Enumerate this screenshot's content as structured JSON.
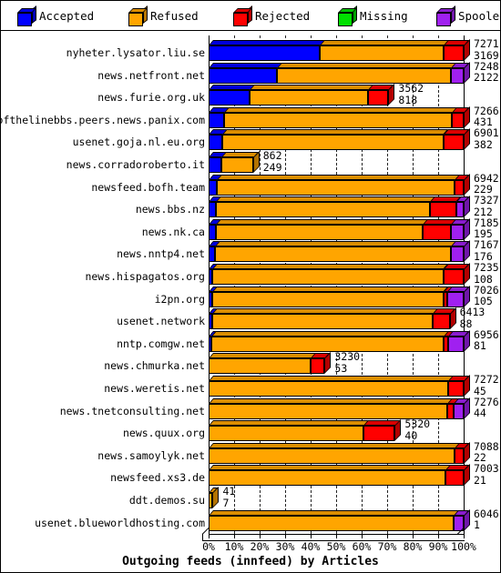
{
  "legend": {
    "items": [
      {
        "label": "Accepted",
        "color": "#0000ff",
        "icon": "cube-icon"
      },
      {
        "label": "Refused",
        "color": "#ffa500",
        "icon": "cube-icon"
      },
      {
        "label": "Rejected",
        "color": "#ff0000",
        "icon": "cube-icon"
      },
      {
        "label": "Missing",
        "color": "#00e000",
        "icon": "cube-icon"
      },
      {
        "label": "Spooled",
        "color": "#a020f0",
        "icon": "cube-icon"
      }
    ]
  },
  "chart_data": {
    "type": "bar",
    "orientation": "horizontal",
    "stacked": true,
    "percent_stacked": true,
    "title": "Outgoing feeds (innfeed) by Articles",
    "xlabel": "Outgoing feeds (innfeed) by Articles",
    "ylabel": "",
    "xlim": [
      0,
      100
    ],
    "xticks": [
      "0%",
      "10%",
      "20%",
      "30%",
      "40%",
      "50%",
      "60%",
      "70%",
      "80%",
      "90%",
      "100%"
    ],
    "grid": true,
    "legend_position": "top",
    "series": [
      {
        "name": "Accepted",
        "color": "#0000ff"
      },
      {
        "name": "Refused",
        "color": "#ffa500"
      },
      {
        "name": "Rejected",
        "color": "#ff0000"
      },
      {
        "name": "Missing",
        "color": "#00e000"
      },
      {
        "name": "Spooled",
        "color": "#a020f0"
      }
    ],
    "categories": [
      "nyheter.lysator.liu.se",
      "news.netfront.net",
      "news.furie.org.uk",
      "endofthelinebbs.peers.news.panix.com",
      "usenet.goja.nl.eu.org",
      "news.corradoroberto.it",
      "newsfeed.bofh.team",
      "news.bbs.nz",
      "news.nk.ca",
      "news.nntp4.net",
      "news.hispagatos.org",
      "i2pn.org",
      "usenet.network",
      "nntp.comgw.net",
      "news.chmurka.net",
      "news.weretis.net",
      "news.tnetconsulting.net",
      "news.quux.org",
      "news.samoylyk.net",
      "newsfeed.xs3.de",
      "ddt.demos.su",
      "usenet.blueworldhosting.com"
    ],
    "rows": [
      {
        "category": "nyheter.lysator.liu.se",
        "total": 7271,
        "value2": 3169,
        "bar_len_pct": 100,
        "labels_inside": false,
        "segments": [
          {
            "s": "Accepted",
            "pct": 43.6
          },
          {
            "s": "Refused",
            "pct": 48.4
          },
          {
            "s": "Rejected",
            "pct": 8.0
          }
        ]
      },
      {
        "category": "news.netfront.net",
        "total": 7248,
        "value2": 2122,
        "bar_len_pct": 100,
        "labels_inside": false,
        "segments": [
          {
            "s": "Accepted",
            "pct": 26.8
          },
          {
            "s": "Refused",
            "pct": 68.2
          },
          {
            "s": "Spooled",
            "pct": 5.0
          }
        ]
      },
      {
        "category": "news.furie.org.uk",
        "total": 3562,
        "value2": 818,
        "bar_len_pct": 70.5,
        "labels_inside": true,
        "segments": [
          {
            "s": "Accepted",
            "pct": 22.9
          },
          {
            "s": "Refused",
            "pct": 66.0
          },
          {
            "s": "Rejected",
            "pct": 11.1
          }
        ]
      },
      {
        "category": "endofthelinebbs.peers.news.panix.com",
        "total": 7266,
        "value2": 431,
        "bar_len_pct": 100,
        "labels_inside": false,
        "segments": [
          {
            "s": "Accepted",
            "pct": 5.9
          },
          {
            "s": "Refused",
            "pct": 89.6
          },
          {
            "s": "Rejected",
            "pct": 4.5
          }
        ]
      },
      {
        "category": "usenet.goja.nl.eu.org",
        "total": 6901,
        "value2": 382,
        "bar_len_pct": 100,
        "labels_inside": false,
        "segments": [
          {
            "s": "Accepted",
            "pct": 5.5
          },
          {
            "s": "Refused",
            "pct": 86.5
          },
          {
            "s": "Rejected",
            "pct": 8.0
          }
        ]
      },
      {
        "category": "news.corradoroberto.it",
        "total": 862,
        "value2": 249,
        "bar_len_pct": 17.4,
        "labels_inside": true,
        "segments": [
          {
            "s": "Accepted",
            "pct": 28.9
          },
          {
            "s": "Refused",
            "pct": 71.1
          }
        ]
      },
      {
        "category": "newsfeed.bofh.team",
        "total": 6942,
        "value2": 229,
        "bar_len_pct": 100,
        "labels_inside": false,
        "segments": [
          {
            "s": "Accepted",
            "pct": 3.3
          },
          {
            "s": "Refused",
            "pct": 93.2
          },
          {
            "s": "Rejected",
            "pct": 3.5
          }
        ]
      },
      {
        "category": "news.bbs.nz",
        "total": 7327,
        "value2": 212,
        "bar_len_pct": 100,
        "labels_inside": false,
        "segments": [
          {
            "s": "Accepted",
            "pct": 2.9
          },
          {
            "s": "Refused",
            "pct": 84.0
          },
          {
            "s": "Rejected",
            "pct": 10.1
          },
          {
            "s": "Spooled",
            "pct": 3.0
          }
        ]
      },
      {
        "category": "news.nk.ca",
        "total": 7185,
        "value2": 195,
        "bar_len_pct": 100,
        "labels_inside": false,
        "segments": [
          {
            "s": "Accepted",
            "pct": 2.7
          },
          {
            "s": "Refused",
            "pct": 81.3
          },
          {
            "s": "Rejected",
            "pct": 11.0
          },
          {
            "s": "Spooled",
            "pct": 5.0
          }
        ]
      },
      {
        "category": "news.nntp4.net",
        "total": 7167,
        "value2": 176,
        "bar_len_pct": 100,
        "labels_inside": false,
        "segments": [
          {
            "s": "Accepted",
            "pct": 2.5
          },
          {
            "s": "Refused",
            "pct": 92.5
          },
          {
            "s": "Spooled",
            "pct": 5.0
          }
        ]
      },
      {
        "category": "news.hispagatos.org",
        "total": 7235,
        "value2": 108,
        "bar_len_pct": 100,
        "labels_inside": false,
        "segments": [
          {
            "s": "Accepted",
            "pct": 1.5
          },
          {
            "s": "Refused",
            "pct": 90.5
          },
          {
            "s": "Rejected",
            "pct": 8.0
          }
        ]
      },
      {
        "category": "i2pn.org",
        "total": 7026,
        "value2": 105,
        "bar_len_pct": 100,
        "labels_inside": false,
        "segments": [
          {
            "s": "Accepted",
            "pct": 1.5
          },
          {
            "s": "Refused",
            "pct": 90.5
          },
          {
            "s": "Rejected",
            "pct": 1.5
          },
          {
            "s": "Spooled",
            "pct": 6.5
          }
        ]
      },
      {
        "category": "usenet.network",
        "total": 6413,
        "value2": 88,
        "bar_len_pct": 94.5,
        "labels_inside": true,
        "segments": [
          {
            "s": "Accepted",
            "pct": 1.4
          },
          {
            "s": "Refused",
            "pct": 91.6
          },
          {
            "s": "Rejected",
            "pct": 7.0
          }
        ]
      },
      {
        "category": "nntp.comgw.net",
        "total": 6956,
        "value2": 81,
        "bar_len_pct": 100,
        "labels_inside": false,
        "segments": [
          {
            "s": "Accepted",
            "pct": 1.2
          },
          {
            "s": "Refused",
            "pct": 91.0
          },
          {
            "s": "Rejected",
            "pct": 1.8
          },
          {
            "s": "Spooled",
            "pct": 6.0
          }
        ]
      },
      {
        "category": "news.chmurka.net",
        "total": 3230,
        "value2": 53,
        "bar_len_pct": 45.5,
        "labels_inside": true,
        "segments": [
          {
            "s": "Refused",
            "pct": 88.0
          },
          {
            "s": "Rejected",
            "pct": 12.0
          }
        ]
      },
      {
        "category": "news.weretis.net",
        "total": 7272,
        "value2": 45,
        "bar_len_pct": 100,
        "labels_inside": false,
        "segments": [
          {
            "s": "Refused",
            "pct": 94.0
          },
          {
            "s": "Rejected",
            "pct": 6.0
          }
        ]
      },
      {
        "category": "news.tnetconsulting.net",
        "total": 7276,
        "value2": 44,
        "bar_len_pct": 100,
        "labels_inside": false,
        "segments": [
          {
            "s": "Refused",
            "pct": 93.5
          },
          {
            "s": "Rejected",
            "pct": 2.5
          },
          {
            "s": "Spooled",
            "pct": 4.0
          }
        ]
      },
      {
        "category": "news.quux.org",
        "total": 5320,
        "value2": 40,
        "bar_len_pct": 73.0,
        "labels_inside": true,
        "segments": [
          {
            "s": "Refused",
            "pct": 83.0
          },
          {
            "s": "Rejected",
            "pct": 17.0
          }
        ]
      },
      {
        "category": "news.samoylyk.net",
        "total": 7088,
        "value2": 22,
        "bar_len_pct": 100,
        "labels_inside": false,
        "segments": [
          {
            "s": "Refused",
            "pct": 96.5
          },
          {
            "s": "Rejected",
            "pct": 3.5
          }
        ]
      },
      {
        "category": "newsfeed.xs3.de",
        "total": 7003,
        "value2": 21,
        "bar_len_pct": 100,
        "labels_inside": false,
        "segments": [
          {
            "s": "Refused",
            "pct": 93.0
          },
          {
            "s": "Rejected",
            "pct": 7.0
          }
        ]
      },
      {
        "category": "ddt.demos.su",
        "total": 41,
        "value2": 7,
        "bar_len_pct": 1.6,
        "labels_inside": true,
        "segments": [
          {
            "s": "Refused",
            "pct": 100
          }
        ]
      },
      {
        "category": "usenet.blueworldhosting.com",
        "total": 6046,
        "value2": 1,
        "bar_len_pct": 100,
        "labels_inside": true,
        "segments": [
          {
            "s": "Refused",
            "pct": 96.0
          },
          {
            "s": "Spooled",
            "pct": 4.0
          }
        ]
      }
    ]
  }
}
